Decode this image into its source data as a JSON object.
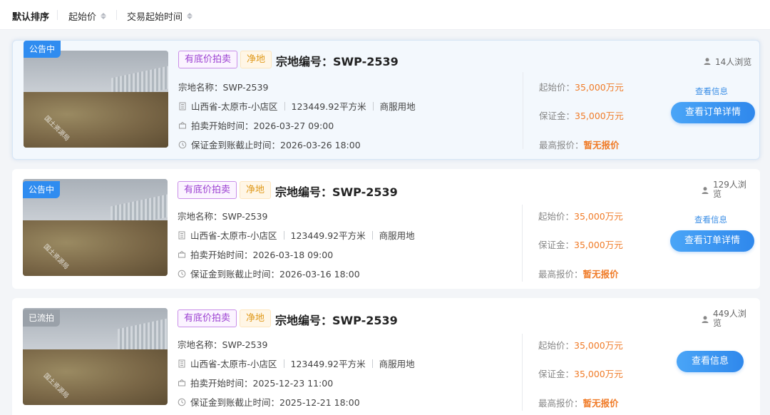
{
  "sort": {
    "default_label": "默认排序",
    "start_price_label": "起始价",
    "trade_time_label": "交易起始时间"
  },
  "labels": {
    "lot_name_prefix": "宗地名称：",
    "auction_start_prefix": "拍卖开始时间：",
    "deposit_deadline_prefix": "保证金到账截止时间：",
    "start_price_prefix": "起始价：",
    "deposit_prefix": "保证金：",
    "highest_bid_prefix": "最高报价：",
    "photo_watermark": "国土资源局"
  },
  "icons": {
    "user": "user-icon",
    "building": "building-icon",
    "gavel": "auction-icon",
    "clock": "clock-icon",
    "sort": "sort-arrows-icon"
  },
  "colors": {
    "accent": "#2f8cf0",
    "price": "#f07b27",
    "tag_purple": "#9b3fd1",
    "tag_orange": "#e09a1c",
    "status_grey": "#9aa1a9"
  },
  "listings": [
    {
      "status": "公告中",
      "tag_1": "有底价拍卖",
      "tag_2": "净地",
      "title": "宗地编号：SWP-2539",
      "lot_name": "SWP-2539",
      "location": "山西省-太原市-小店区",
      "area": "123449.92平方米",
      "usage": "商服用地",
      "auction_start": "2026-03-27 09:00",
      "deposit_deadline": "2026-03-26 18:00",
      "start_price": "35,000万元",
      "deposit": "35,000万元",
      "highest_bid": "暂无报价",
      "views_line1": "14人浏览",
      "views_line2": "",
      "info_link": "查看信息",
      "primary_button": "查看订单详情"
    },
    {
      "status": "公告中",
      "tag_1": "有底价拍卖",
      "tag_2": "净地",
      "title": "宗地编号：SWP-2539",
      "lot_name": "SWP-2539",
      "location": "山西省-太原市-小店区",
      "area": "123449.92平方米",
      "usage": "商服用地",
      "auction_start": "2026-03-18 09:00",
      "deposit_deadline": "2026-03-16 18:00",
      "start_price": "35,000万元",
      "deposit": "35,000万元",
      "highest_bid": "暂无报价",
      "views_line1": "129人浏",
      "views_line2": "览",
      "info_link": "查看信息",
      "primary_button": "查看订单详情"
    },
    {
      "status": "已流拍",
      "tag_1": "有底价拍卖",
      "tag_2": "净地",
      "title": "宗地编号：SWP-2539",
      "lot_name": "SWP-2539",
      "location": "山西省-太原市-小店区",
      "area": "123449.92平方米",
      "usage": "商服用地",
      "auction_start": "2025-12-23 11:00",
      "deposit_deadline": "2025-12-21 18:00",
      "start_price": "35,000万元",
      "deposit": "35,000万元",
      "highest_bid": "暂无报价",
      "views_line1": "449人浏",
      "views_line2": "览",
      "info_link": "",
      "primary_button": "查看信息"
    }
  ]
}
